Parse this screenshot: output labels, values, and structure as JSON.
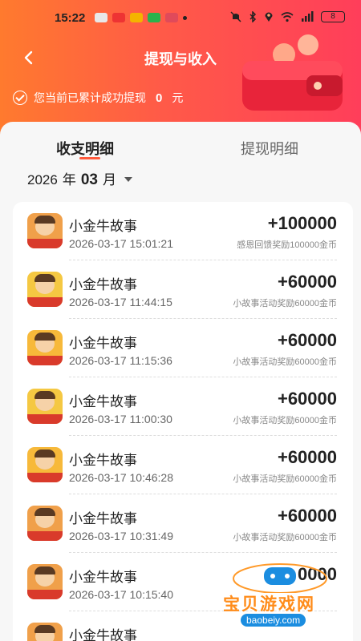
{
  "status_bar": {
    "time": "15:22",
    "battery": "8"
  },
  "header": {
    "title": "提现与收入",
    "summary_prefix": "您当前已累计成功提现",
    "summary_amount": "0",
    "summary_unit": "元"
  },
  "tabs": [
    {
      "label": "收支明细",
      "active": true
    },
    {
      "label": "提现明细",
      "active": false
    }
  ],
  "month_picker": {
    "year": "2026",
    "year_unit": "年",
    "month": "03",
    "month_unit": "月"
  },
  "records": [
    {
      "title": "小金牛故事",
      "date": "2026-03-17 15:01:21",
      "amount": "+100000",
      "desc": "感恩回馈奖励100000金币",
      "icon_bg": "#f0a04a"
    },
    {
      "title": "小金牛故事",
      "date": "2026-03-17 11:44:15",
      "amount": "+60000",
      "desc": "小故事活动奖励60000金币",
      "icon_bg": "#f5c842"
    },
    {
      "title": "小金牛故事",
      "date": "2026-03-17 11:15:36",
      "amount": "+60000",
      "desc": "小故事活动奖励60000金币",
      "icon_bg": "#f7b93a"
    },
    {
      "title": "小金牛故事",
      "date": "2026-03-17 11:00:30",
      "amount": "+60000",
      "desc": "小故事活动奖励60000金币",
      "icon_bg": "#f5c842"
    },
    {
      "title": "小金牛故事",
      "date": "2026-03-17 10:46:28",
      "amount": "+60000",
      "desc": "小故事活动奖励60000金币",
      "icon_bg": "#f7b93a"
    },
    {
      "title": "小金牛故事",
      "date": "2026-03-17 10:31:49",
      "amount": "+60000",
      "desc": "小故事活动奖励60000金币",
      "icon_bg": "#f0a04a"
    },
    {
      "title": "小金牛故事",
      "date": "2026-03-17 10:15:40",
      "amount": "0000",
      "desc": "",
      "icon_bg": "#f0a04a"
    },
    {
      "title": "小金牛故事",
      "date": "",
      "amount": "",
      "desc": "",
      "icon_bg": "#f0a04a"
    }
  ],
  "watermark": {
    "text": "宝贝游戏网",
    "url": "baobeiy.com"
  },
  "colors": {
    "accent": "#ff5a3c",
    "header_start": "#ff7a2e",
    "header_end": "#ff3e5a"
  }
}
